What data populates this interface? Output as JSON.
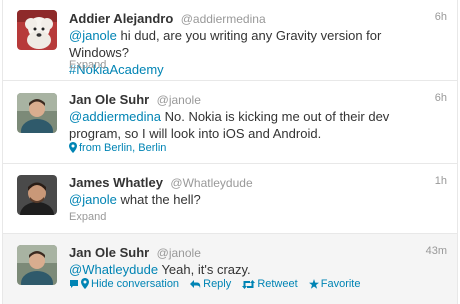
{
  "tweets": [
    {
      "fullname": "Addier Alejandro",
      "username": "@addiermedina",
      "time": "6h",
      "mention": "@janole",
      "text": " hi dud, are you writing any Gravity version for Windows?",
      "hashtag": "#NokiaAcademy",
      "expand": "Expand",
      "avatar": "poodle-avatar"
    },
    {
      "fullname": "Jan Ole Suhr",
      "username": "@janole",
      "time": "6h",
      "mention": "@addiermedina",
      "text": " No. Nokia is kicking me out of their dev program, so I will look into iOS and Android.",
      "location": "from Berlin, Berlin",
      "avatar": "person-avatar"
    },
    {
      "fullname": "James Whatley",
      "username": "@Whatleydude",
      "time": "1h",
      "mention": "@janole",
      "text": " what the hell?",
      "expand": "Expand",
      "avatar": "person-avatar"
    },
    {
      "fullname": "Jan Ole Suhr",
      "username": "@janole",
      "time": "43m",
      "mention": "@Whatleydude",
      "text": " Yeah, it's crazy.",
      "actions": {
        "hide_conversation": "Hide conversation",
        "reply": "Reply",
        "retweet": "Retweet",
        "favorite": "Favorite"
      },
      "avatar": "person-avatar"
    }
  ],
  "colors": {
    "link": "#0084b4",
    "muted": "#999999",
    "text": "#333333",
    "highlight_bg": "#f5f5f5"
  }
}
